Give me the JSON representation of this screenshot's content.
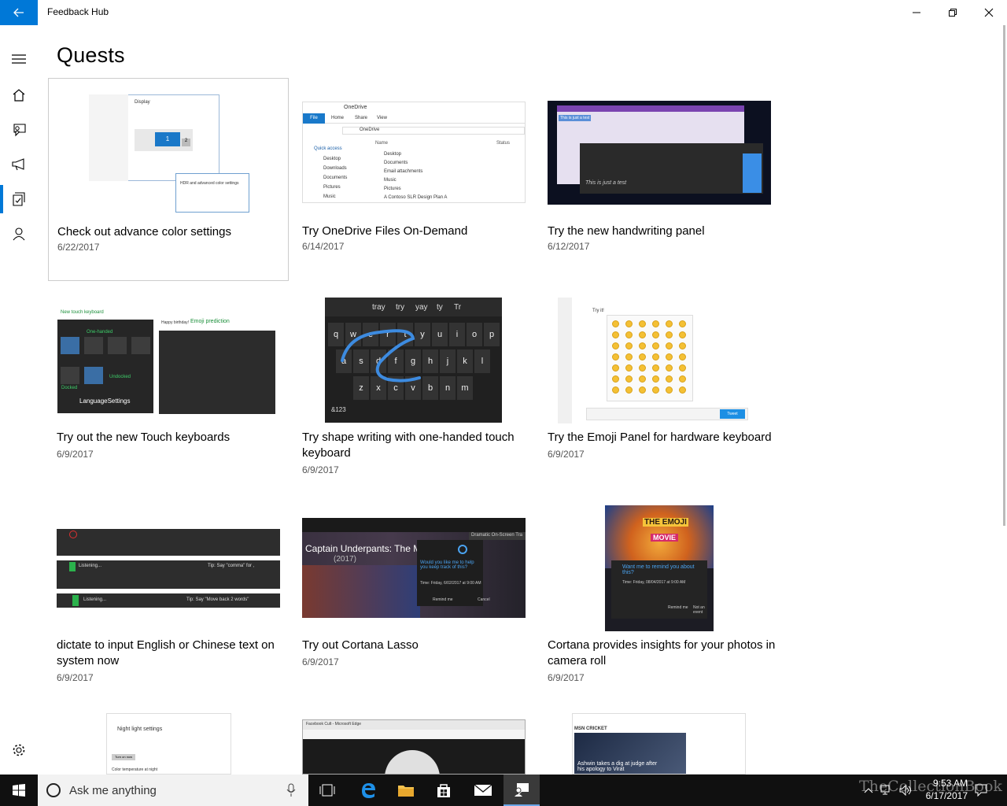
{
  "app": {
    "title": "Feedback Hub"
  },
  "page": {
    "title": "Quests"
  },
  "quests": [
    {
      "title": "Check out advance color settings",
      "date": "6/22/2017"
    },
    {
      "title": "Try OneDrive Files On-Demand",
      "date": "6/14/2017"
    },
    {
      "title": "Try the new handwriting panel",
      "date": "6/12/2017"
    },
    {
      "title": "Try out the new Touch keyboards",
      "date": "6/9/2017"
    },
    {
      "title": "Try shape writing with one-handed touch keyboard",
      "date": "6/9/2017"
    },
    {
      "title": "Try the Emoji Panel for hardware keyboard",
      "date": "6/9/2017"
    },
    {
      "title": "dictate to input English or Chinese text on system now",
      "date": "6/9/2017"
    },
    {
      "title": "Try out Cortana Lasso",
      "date": "6/9/2017"
    },
    {
      "title": "Cortana provides insights for your photos in camera roll",
      "date": "6/9/2017"
    }
  ],
  "thumbs": {
    "color": {
      "heading": "Display",
      "popup": "HDR and advanced color settings",
      "monitor": "1",
      "monitor2": "2"
    },
    "onedrive": {
      "title": "OneDrive",
      "file": "File",
      "home": "Home",
      "share": "Share",
      "view": "View",
      "path": "OneDrive",
      "name_col": "Name",
      "status_col": "Status",
      "quick": "Quick access",
      "nav": [
        "Desktop",
        "Downloads",
        "Documents",
        "Pictures",
        "Music"
      ],
      "files": [
        "Desktop",
        "Documents",
        "Email attachments",
        "Music",
        "Pictures",
        "A Contoso SLR Design Plan A"
      ]
    },
    "handwriting": {
      "note": "This is just a test",
      "ink": "This is just a test"
    },
    "touch": {
      "new_kb": "New touch keyboard",
      "one_handed": "One-handed",
      "emoji_pred": "Emoji prediction",
      "undocked": "Undocked",
      "docked": "Docked",
      "lang": "LanguageSettings",
      "happy": "Happy birthday!"
    },
    "shape": {
      "suggestions": [
        "tray",
        "try",
        "yay",
        "ty",
        "Tr"
      ],
      "row1": [
        "q",
        "w",
        "e",
        "r",
        "t",
        "y",
        "u",
        "i",
        "o",
        "p"
      ],
      "row2": [
        "a",
        "s",
        "d",
        "f",
        "g",
        "h",
        "j",
        "k",
        "l"
      ],
      "row3": [
        "z",
        "x",
        "c",
        "v",
        "b",
        "n",
        "m"
      ],
      "num": "&123"
    },
    "emoji": {
      "try": "Try it!",
      "tweet": "Tweet"
    },
    "dictate": {
      "listening1": "Listening...",
      "listening2": "Listening...",
      "tip1": "Tip: Say \"comma\" for ,",
      "tip2": "Tip: Say \"Move back 2 words\""
    },
    "lasso": {
      "movie": "Captain Underpants: The Movie",
      "year": "(2017)",
      "prompt": "Would you like me to help you keep track of this?",
      "time": "Time: Friday, 6/02/2017 at 9:00 AM",
      "remind": "Remind me",
      "cancel": "Cancel",
      "tab": "Dramatic On-Screen Tra"
    },
    "insights": {
      "brand": "THE EMOJI",
      "movie": "MOVIE",
      "prompt": "Want me to remind you about this?",
      "time": "Time: Friday, 08/04/2017 at 9:00 AM",
      "remind": "Remind me",
      "not": "Not an event"
    },
    "nightlight": {
      "title": "Night light settings",
      "temp": "Color temperature at night",
      "btn": "Turn on now"
    },
    "facebook": {
      "title": "Facebook Cult - Microsoft Edge"
    },
    "cricket": {
      "title": "MSN CRICKET",
      "caption": "Ashwin takes a dig at judge after his apology to Virat"
    }
  },
  "taskbar": {
    "search_placeholder": "Ask me anything",
    "time": "9:53 AM",
    "date": "6/17/2017",
    "watermark": "TheCollectionBook"
  }
}
